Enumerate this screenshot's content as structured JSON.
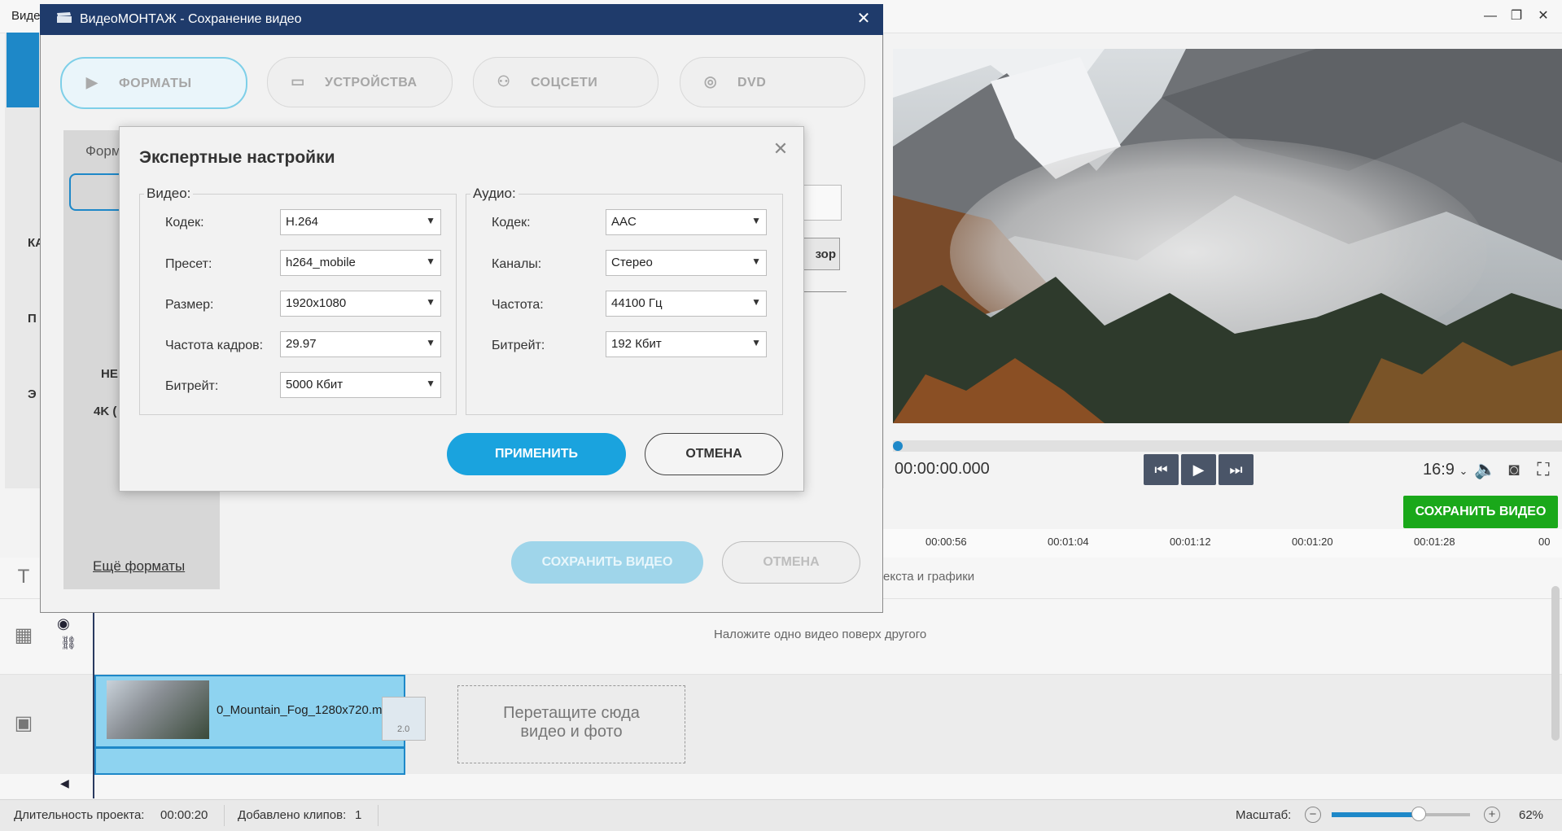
{
  "app": {
    "title": "Виде",
    "window_controls": {
      "minimize": "—",
      "maximize": "❐",
      "close": "✕"
    },
    "left_fragments": {
      "ka": "КА",
      "p": "П",
      "e": "Э"
    }
  },
  "preview": {
    "timecode": "00:00:00.000",
    "aspect": "16:9",
    "save_video_label": "СОХРАНИТЬ ВИДЕО"
  },
  "timeline": {
    "ticks": [
      "00:00:56",
      "00:01:04",
      "00:01:12",
      "00:01:20",
      "00:01:28",
      "00"
    ],
    "text_track_hint": "екста и графики",
    "overlay_track_hint": "Наложите одно видео поверх другого",
    "clip_name": "0_Mountain_Fog_1280x720.m",
    "transition_value": "2.0",
    "drop_zone_line1": "Перетащите сюда",
    "drop_zone_line2": "видео и фото"
  },
  "statusbar": {
    "duration_label": "Длительность проекта:",
    "duration_value": "00:00:20",
    "clips_label": "Добавлено клипов:",
    "clips_value": "1",
    "zoom_label": "Масштаб:",
    "zoom_percent": "62%",
    "zoom_level": 0.62
  },
  "save_dialog": {
    "title": "ВидеоМОНТАЖ - Сохранение видео",
    "tabs": [
      {
        "label": "ФОРМАТЫ",
        "icon": "play-square-icon",
        "active": true
      },
      {
        "label": "УСТРОЙСТВА",
        "icon": "monitor-icon",
        "active": false
      },
      {
        "label": "СОЦСЕТИ",
        "icon": "share-icon",
        "active": false
      },
      {
        "label": "DVD",
        "icon": "disc-icon",
        "active": false
      }
    ],
    "panel_title_fragment": "Форм",
    "fragment_ne": "НЕ",
    "fragment_4k": "4K (",
    "more_formats": "Ещё форматы",
    "browse_fragment": "зор",
    "save_video": "СОХРАНИТЬ ВИДЕО",
    "cancel": "ОТМЕНА"
  },
  "expert_dialog": {
    "title": "Экспертные настройки",
    "video_group": "Видео:",
    "audio_group": "Аудио:",
    "video_fields": [
      {
        "label": "Кодек:",
        "value": "H.264"
      },
      {
        "label": "Пресет:",
        "value": "h264_mobile"
      },
      {
        "label": "Размер:",
        "value": "1920x1080"
      },
      {
        "label": "Частота кадров:",
        "value": "29.97"
      },
      {
        "label": "Битрейт:",
        "value": "5000 Кбит"
      }
    ],
    "audio_fields": [
      {
        "label": "Кодек:",
        "value": "AAC"
      },
      {
        "label": "Каналы:",
        "value": "Стерео"
      },
      {
        "label": "Частота:",
        "value": "44100 Гц"
      },
      {
        "label": "Битрейт:",
        "value": "192 Кбит"
      }
    ],
    "apply": "ПРИМЕНИТЬ",
    "cancel": "ОТМЕНА"
  },
  "colors": {
    "titlebar": "#1f3b6b",
    "accent": "#1aa3de",
    "save_green": "#1aa81a"
  }
}
